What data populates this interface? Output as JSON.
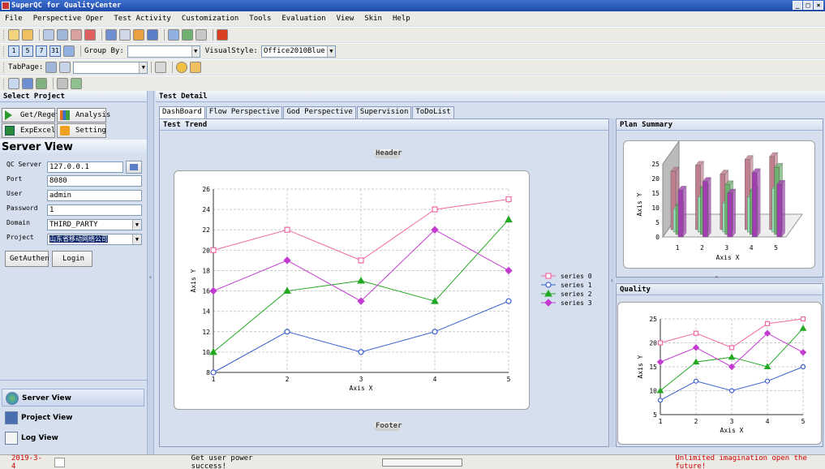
{
  "window": {
    "title": "SuperQC for QualityCenter"
  },
  "menu": [
    "File",
    "Perspective Oper",
    "Test Activity",
    "Customization",
    "Tools",
    "Evaluation",
    "View",
    "Skin",
    "Help"
  ],
  "toolbar2": {
    "nums": [
      "1",
      "5",
      "7",
      "31"
    ],
    "group_by_label": "Group By:",
    "group_by_value": "",
    "visual_style_label": "VisualStyle:",
    "visual_style_value": "Office2010Blue"
  },
  "toolbar3": {
    "tabpage_label": "TabPage:",
    "tabpage_value": ""
  },
  "left": {
    "select_project": "Select Project",
    "buttons": {
      "get_reget": "Get/Reget",
      "analysis": "Analysis",
      "exp_excel": "ExpExcel",
      "setting": "Setting"
    },
    "server_view_title": "Server View",
    "fields": {
      "qc_server_label": "QC Server",
      "qc_server_value": "127.0.0.1",
      "port_label": "Port",
      "port_value": "8080",
      "user_label": "User",
      "user_value": "admin",
      "password_label": "Password",
      "password_value": "1",
      "domain_label": "Domain",
      "domain_value": "THIRD_PARTY",
      "project_label": "Project",
      "project_value": "山东省移动网络公司"
    },
    "get_authen": "GetAuthen",
    "login": "Login",
    "nav": [
      "Server View",
      "Project View",
      "Log View"
    ]
  },
  "main": {
    "test_detail": "Test Detail",
    "tabs": [
      "DashBoard",
      "Flow Perspective",
      "God Perspective",
      "Supervision",
      "ToDoList"
    ],
    "test_trend": "Test Trend",
    "plan_summary": "Plan Summary",
    "quality": "Quality",
    "header_pill": "Header",
    "footer_pill": "Footer"
  },
  "status": {
    "date": "2019-3-4",
    "message": "Get user power success!",
    "slogan": "Unlimited imagination open the future!"
  },
  "colors": {
    "series0": "#f06aa4",
    "series1": "#3a5fcd",
    "series2": "#22a822",
    "series3": "#c33bd0",
    "slogan": "#cc0000"
  },
  "chart_data": [
    {
      "type": "line",
      "x": [
        1,
        2,
        3,
        4,
        5
      ],
      "series": [
        {
          "name": "series 0",
          "values": [
            20,
            22,
            19,
            24,
            25
          ]
        },
        {
          "name": "series 1",
          "values": [
            8,
            12,
            10,
            12,
            15
          ]
        },
        {
          "name": "series 2",
          "values": [
            10,
            16,
            17,
            15,
            23
          ]
        },
        {
          "name": "series 3",
          "values": [
            16,
            19,
            15,
            22,
            18
          ]
        }
      ],
      "xlabel": "Axis X",
      "ylabel": "Axis Y",
      "ylim": [
        8,
        26
      ],
      "yticks": [
        8,
        10,
        12,
        14,
        16,
        18,
        20,
        22,
        24,
        26
      ],
      "xticks": [
        1,
        2,
        3,
        4,
        5
      ],
      "grid": true,
      "legend": "right"
    },
    {
      "type": "bar",
      "x": [
        1,
        2,
        3,
        4,
        5
      ],
      "series": [
        {
          "name": "series 0",
          "values": [
            20,
            22,
            19,
            24,
            25
          ]
        },
        {
          "name": "series 1",
          "values": [
            8,
            12,
            10,
            12,
            15
          ]
        },
        {
          "name": "series 2",
          "values": [
            10,
            16,
            17,
            15,
            23
          ]
        },
        {
          "name": "series 3",
          "values": [
            16,
            19,
            15,
            22,
            18
          ]
        }
      ],
      "xlabel": "Axis X",
      "ylabel": "Axis Y",
      "ylim": [
        0,
        25
      ],
      "yticks": [
        0,
        5,
        10,
        15,
        20,
        25
      ],
      "xticks": [
        1,
        2,
        3,
        4,
        5
      ]
    },
    {
      "type": "line",
      "x": [
        1,
        2,
        3,
        4,
        5
      ],
      "series": [
        {
          "name": "series 0",
          "values": [
            20,
            22,
            19,
            24,
            25
          ]
        },
        {
          "name": "series 1",
          "values": [
            8,
            12,
            10,
            12,
            15
          ]
        },
        {
          "name": "series 2",
          "values": [
            10,
            16,
            17,
            15,
            23
          ]
        },
        {
          "name": "series 3",
          "values": [
            16,
            19,
            15,
            22,
            18
          ]
        }
      ],
      "xlabel": "Axis X",
      "ylabel": "Axis Y",
      "ylim": [
        5,
        25
      ],
      "yticks": [
        5,
        10,
        15,
        20,
        25
      ],
      "xticks": [
        1,
        2,
        3,
        4,
        5
      ],
      "grid": true
    }
  ]
}
